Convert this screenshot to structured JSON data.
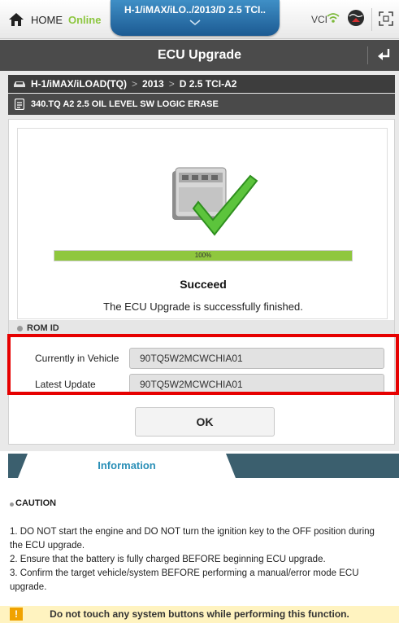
{
  "topbar": {
    "home_label": "HOME",
    "status": "Online",
    "vehicle": "H-1/iMAX/iLO../2013/D 2.5 TCI..",
    "vci_label": "VCI"
  },
  "titlebar": {
    "title": "ECU Upgrade"
  },
  "breadcrumb": {
    "items": [
      "H-1/iMAX/iLOAD(TQ)",
      "2013",
      "D 2.5 TCI-A2"
    ],
    "separator": ">"
  },
  "subtitle": "340.TQ A2 2.5 OIL LEVEL SW LOGIC ERASE",
  "result": {
    "progress_percent": 100,
    "progress_label": "100%",
    "status": "Succeed",
    "message": "The ECU Upgrade is successfully finished."
  },
  "rom": {
    "title": "ROM ID",
    "rows": [
      {
        "label": "Currently in Vehicle",
        "value": "90TQ5W2MCWCHIA01"
      },
      {
        "label": "Latest Update",
        "value": "90TQ5W2MCWCHIA01"
      }
    ]
  },
  "ok_label": "OK",
  "information": {
    "tab_label": "Information",
    "caution_title": "CAUTION",
    "notes": [
      "1. DO NOT start the engine and DO NOT turn the ignition key to the OFF position during the ECU upgrade.",
      "2. Ensure that the battery is fully charged BEFORE beginning ECU upgrade.",
      "3. Confirm the target vehicle/system BEFORE performing a manual/error mode ECU upgrade."
    ]
  },
  "warning": {
    "icon": "!",
    "text": "Do not touch any system buttons while performing this function."
  },
  "colors": {
    "online": "#8cc63f",
    "progress": "#8fc73e",
    "accent": "#2a8fb7",
    "highlight": "#e60000",
    "warning_bg": "#fff3c0"
  }
}
